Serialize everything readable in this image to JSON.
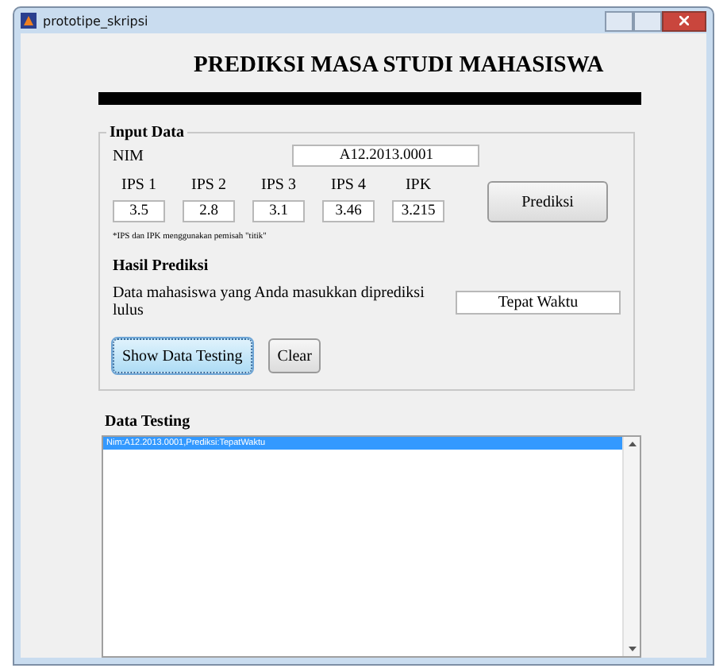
{
  "window": {
    "title": "prototipe_skripsi"
  },
  "heading": "PREDIKSI MASA STUDI MAHASISWA",
  "input_data": {
    "title": "Input Data",
    "nim_label": "NIM",
    "nim_value": "A12.2013.0001",
    "scores": [
      {
        "label": "IPS 1",
        "value": "3.5"
      },
      {
        "label": "IPS 2",
        "value": "2.8"
      },
      {
        "label": "IPS 3",
        "value": "3.1"
      },
      {
        "label": "IPS 4",
        "value": "3.46"
      },
      {
        "label": "IPK",
        "value": "3.215"
      }
    ],
    "predict_button": "Prediksi",
    "note": "*IPS dan IPK menggunakan pemisah \"titik\"",
    "result_title": "Hasil Prediksi",
    "result_text": "Data mahasiswa yang Anda masukkan diprediksi lulus",
    "result_value": "Tepat Waktu",
    "buttons": [
      {
        "label": "Show Data Testing",
        "focused": true
      },
      {
        "label": "Clear",
        "focused": false
      }
    ]
  },
  "data_testing": {
    "title": "Data Testing",
    "items": [
      {
        "text": "Nim:A12.2013.0001,Prediksi:TepatWaktu",
        "selected": true
      }
    ]
  }
}
